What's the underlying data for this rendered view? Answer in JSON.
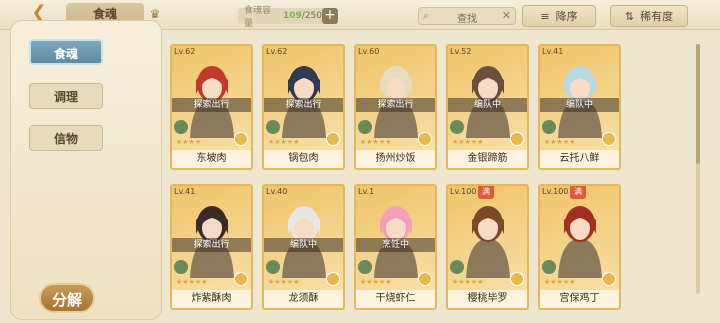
{
  "header": {
    "back_icon": "back-arrow-icon",
    "current_tab": "食魂",
    "crown_icon": "crown-icon",
    "capacity_label": "食魂容量",
    "capacity_current": "109",
    "capacity_max": "/250",
    "plus": "+"
  },
  "search": {
    "placeholder": "查找",
    "icon": "search-icon",
    "clear": "✕"
  },
  "sort": {
    "order_label": "降序",
    "order_icon": "≡",
    "rarity_label": "稀有度",
    "rarity_icon": "⇅"
  },
  "sidebar": {
    "items": [
      {
        "label": "食魂",
        "active": true
      },
      {
        "label": "调理",
        "active": false
      },
      {
        "label": "信物",
        "active": false
      }
    ],
    "decompose": "分解"
  },
  "cards": [
    {
      "lv": "Lv.62",
      "status": "探索出行",
      "name": "东坡肉",
      "stars": "★★★★",
      "tag": "",
      "bg": "#f0c46a",
      "hair": "#c0392b"
    },
    {
      "lv": "Lv.62",
      "status": "探索出行",
      "name": "锅包肉",
      "stars": "★★★★★",
      "tag": "",
      "bg": "#f0c46a",
      "hair": "#2f3b52"
    },
    {
      "lv": "Lv.60",
      "status": "探索出行",
      "name": "扬州炒饭",
      "stars": "★★★★★",
      "tag": "",
      "bg": "#f0c46a",
      "hair": "#e6dcc0"
    },
    {
      "lv": "Lv.52",
      "status": "编队中",
      "name": "金银蹄筋",
      "stars": "★★★★★",
      "tag": "",
      "bg": "#f0c46a",
      "hair": "#6b5040"
    },
    {
      "lv": "Lv.41",
      "status": "编队中",
      "name": "云托八鲜",
      "stars": "★★★★★",
      "tag": "",
      "bg": "#f0c46a",
      "hair": "#b8d8e8"
    },
    {
      "lv": "Lv.41",
      "status": "探索出行",
      "name": "炸紫酥肉",
      "stars": "★★★★★",
      "tag": "",
      "bg": "#f0c46a",
      "hair": "#3a2a2a"
    },
    {
      "lv": "Lv.40",
      "status": "编队中",
      "name": "龙须酥",
      "stars": "★★★★★",
      "tag": "",
      "bg": "#f0c46a",
      "hair": "#e8e8e8"
    },
    {
      "lv": "Lv.1",
      "status": "烹饪中",
      "name": "干烧虾仁",
      "stars": "★★★★★",
      "tag": "",
      "bg": "#f0c46a",
      "hair": "#f0a0b8"
    },
    {
      "lv": "Lv.100",
      "status": "",
      "name": "樱桃毕罗",
      "stars": "★★★★★",
      "tag": "满",
      "bg": "#f0c46a",
      "hair": "#7a4a2a"
    },
    {
      "lv": "Lv.100",
      "status": "",
      "name": "宫保鸡丁",
      "stars": "★★★★★",
      "tag": "满",
      "bg": "#f0c46a",
      "hair": "#a03020"
    }
  ]
}
